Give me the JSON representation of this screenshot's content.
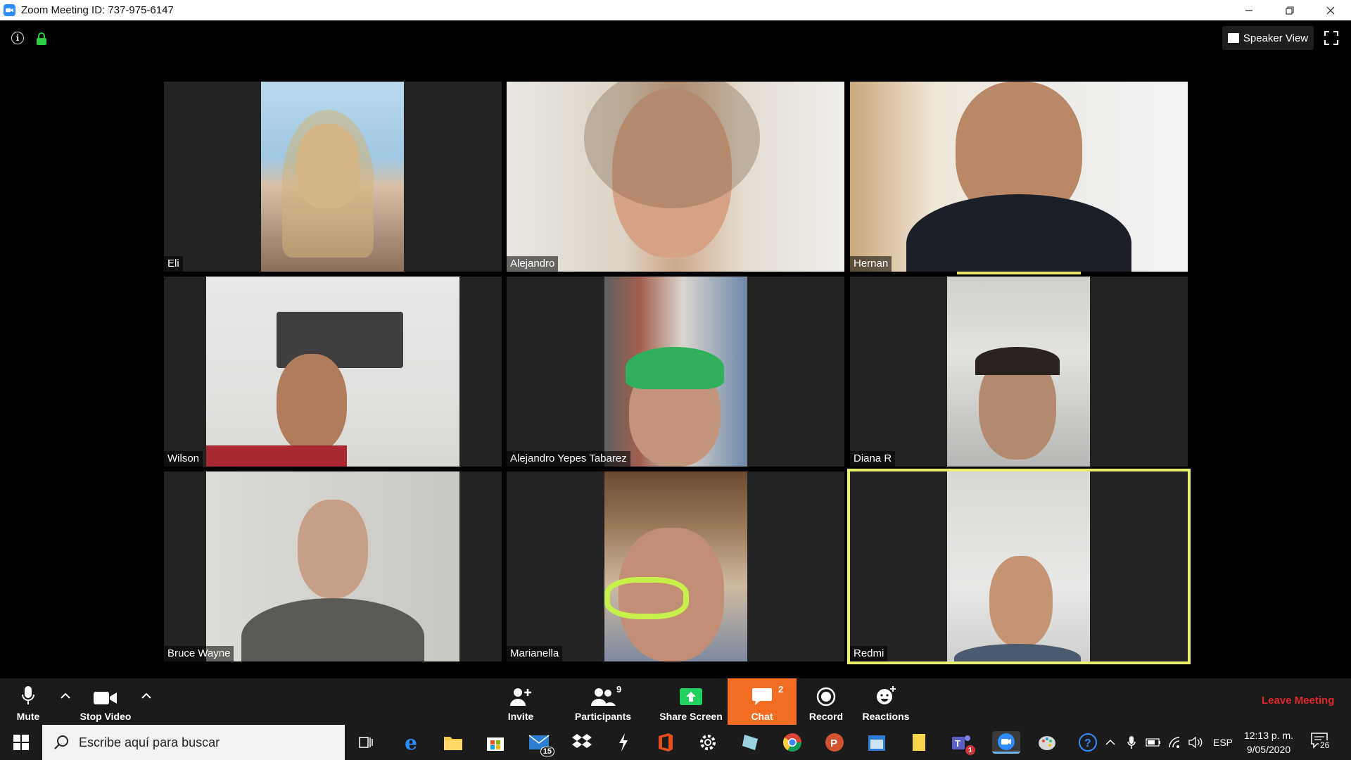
{
  "window": {
    "title": "Zoom Meeting ID: 737-975-6147",
    "controls": [
      "minimize",
      "restore",
      "close"
    ]
  },
  "meeting": {
    "view_mode": "Speaker View",
    "participants": [
      {
        "name": "Eli"
      },
      {
        "name": "Alejandro"
      },
      {
        "name": "Hernan"
      },
      {
        "name": "Wilson"
      },
      {
        "name": "Alejandro Yepes Tabarez"
      },
      {
        "name": "Diana R"
      },
      {
        "name": "Bruce Wayne"
      },
      {
        "name": "Marianella"
      },
      {
        "name": "Redmi"
      }
    ]
  },
  "toolbar": {
    "mute": "Mute",
    "stop_video": "Stop Video",
    "invite": "Invite",
    "participants": "Participants",
    "participants_count": "9",
    "share_screen": "Share Screen",
    "chat": "Chat",
    "chat_count": "2",
    "record": "Record",
    "reactions": "Reactions",
    "leave": "Leave Meeting"
  },
  "taskbar": {
    "search_placeholder": "Escribe aquí para buscar",
    "mail_badge": "15",
    "teams_badge": "1",
    "language": "ESP",
    "time": "12:13 p. m.",
    "date": "9/05/2020",
    "notifications": "26"
  },
  "colors": {
    "accent": "#2d8cff",
    "chat_active": "#f26d21",
    "leave": "#e02828",
    "active_speaker": "#e9f06f"
  }
}
